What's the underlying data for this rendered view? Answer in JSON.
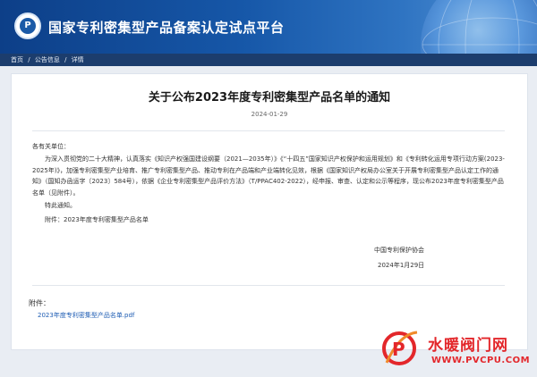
{
  "header": {
    "site_title": "国家专利密集型产品备案认定试点平台",
    "logo_icon": "patent-logo-icon",
    "logo_letter": "P"
  },
  "breadcrumb": {
    "items": [
      "首页",
      "公告信息",
      "详情"
    ],
    "separator": "/"
  },
  "article": {
    "title": "关于公布2023年度专利密集型产品名单的通知",
    "date": "2024-01-29",
    "greeting": "各有关单位：",
    "paragraph": "为深入贯彻党的二十大精神，认真落实《知识产权强国建设纲要（2021—2035年）》《“十四五”国家知识产权保护和运用规划》和《专利转化运用专项行动方案(2023-2025年)》，加强专利密集型产业培育、推广专利密集型产品、推动专利在产品端和产业端转化见效，根据《国家知识产权局办公室关于开展专利密集型产品认定工作的通知》（国知办函运字〔2023〕584号），依据《企业专利密集型产品评价方法》（T/PPAC402-2022），经申报、审查、认定和公示等程序，现公布2023年度专利密集型产品名单（见附件）。",
    "notice": "特此通知。",
    "attachment_line": "附件：2023年度专利密集型产品名单",
    "signature_org": "中国专利保护协会",
    "signature_date": "2024年1月29日"
  },
  "attachments": {
    "label": "附件：",
    "files": [
      "2023年度专利密集型产品名单.pdf"
    ]
  },
  "watermark": {
    "text": "水暖阀门网",
    "url": "WWW.PVCPU.COM",
    "logo_letter": "P"
  },
  "colors": {
    "header_dark": "#0d3f88",
    "header_light": "#5a96d6",
    "breadcrumb_bar": "#1c3d6d",
    "link": "#1d5cb3",
    "watermark": "#e3272b"
  }
}
